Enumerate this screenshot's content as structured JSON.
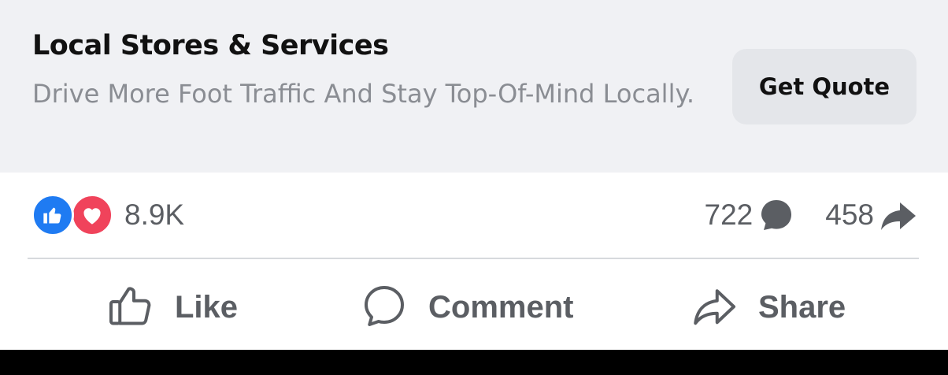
{
  "banner": {
    "title": "Local Stores & Services",
    "description": "Drive More Foot Traffic And Stay Top-Of-Mind Locally.",
    "cta_label": "Get Quote",
    "background": "#f0f1f4"
  },
  "stats": {
    "reactions_count": "8.9K",
    "reaction_types": [
      "like-icon",
      "love-icon"
    ],
    "comments_count": "722",
    "shares_count": "458"
  },
  "actions": {
    "like_label": "Like",
    "comment_label": "Comment",
    "share_label": "Share"
  },
  "colors": {
    "like_blue": "#1f7bf2",
    "love_red": "#f0435b",
    "text_gray": "#5b5e63"
  }
}
